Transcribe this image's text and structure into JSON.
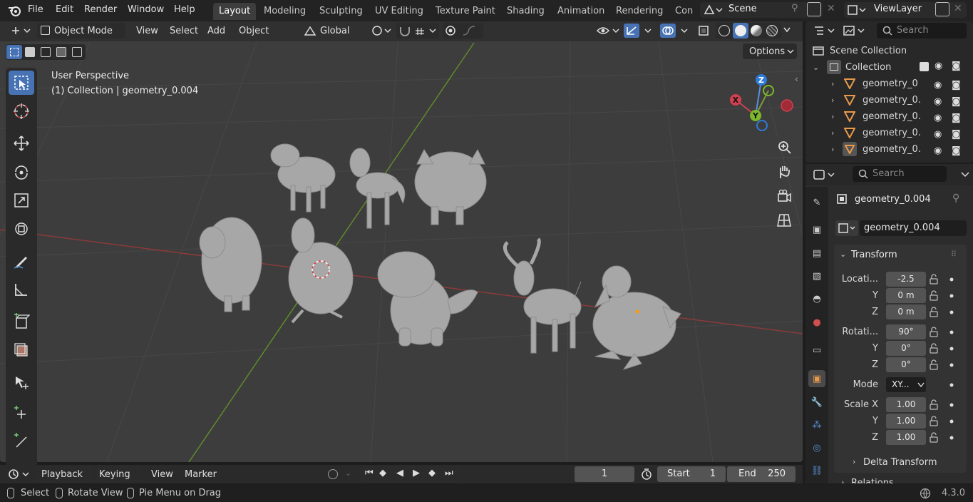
{
  "menubar": {
    "file": "File",
    "edit": "Edit",
    "render": "Render",
    "window": "Window",
    "help": "Help"
  },
  "workspaces": [
    "Layout",
    "Modeling",
    "Sculpting",
    "UV Editing",
    "Texture Paint",
    "Shading",
    "Animation",
    "Rendering",
    "Con"
  ],
  "scene": "Scene",
  "viewlayer": "ViewLayer",
  "viewport_header": {
    "mode": "Object Mode",
    "view": "View",
    "select": "Select",
    "add": "Add",
    "object": "Object",
    "orientation": "Global",
    "options": "Options"
  },
  "viewport": {
    "perspective": "User Perspective",
    "collection_info": "(1) Collection | geometry_0.004"
  },
  "gizmo": {
    "z": "Z",
    "x": "X",
    "y": "Y"
  },
  "outliner": {
    "search_placeholder": "Search",
    "scene_collection": "Scene Collection",
    "collection": "Collection",
    "items": [
      "geometry_0",
      "geometry_0.",
      "geometry_0.",
      "geometry_0.",
      "geometry_0."
    ]
  },
  "properties": {
    "search_placeholder": "Search",
    "object_name": "geometry_0.004",
    "data_name": "geometry_0.004",
    "transform_label": "Transform",
    "location_label": "Locati...",
    "loc_x": "-2.5",
    "loc_y": "0 m",
    "loc_z": "0 m",
    "rotation_label": "Rotati...",
    "rot_x": "90°",
    "rot_y": "0°",
    "rot_z": "0°",
    "mode_label": "Mode",
    "mode_value": "XY...",
    "scale_label": "Scale X",
    "scale_x": "1.00",
    "scale_y": "1.00",
    "scale_z": "1.00",
    "y": "Y",
    "z": "Z",
    "delta_transform": "Delta Transform",
    "relations": "Relations"
  },
  "timeline": {
    "playback": "Playback",
    "keying": "Keying",
    "view": "View",
    "marker": "Marker",
    "current_frame": "1",
    "start_label": "Start",
    "start": "1",
    "end_label": "End",
    "end": "250"
  },
  "statusbar": {
    "select": "Select",
    "rotate_view": "Rotate View",
    "pie_menu": "Pie Menu on Drag",
    "version": "4.3.0"
  }
}
